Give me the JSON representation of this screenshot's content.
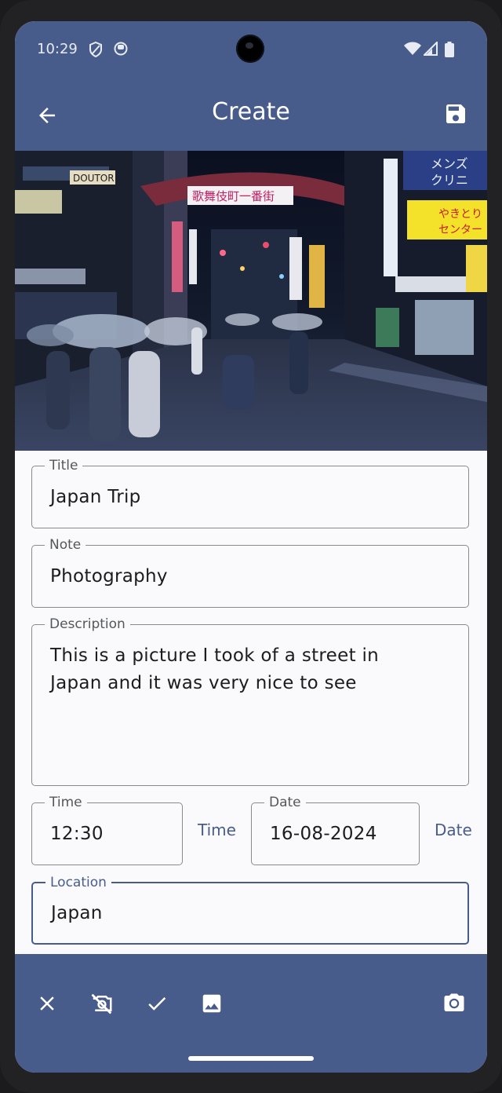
{
  "status": {
    "time": "10:29"
  },
  "appbar": {
    "title": "Create"
  },
  "form": {
    "title": {
      "label": "Title",
      "value": "Japan Trip"
    },
    "note": {
      "label": "Note",
      "value": "Photography"
    },
    "description": {
      "label": "Description",
      "value": "This is a picture I took of a street in Japan and it was very nice to see"
    },
    "time": {
      "label": "Time",
      "value": "12:30",
      "button": "Time"
    },
    "date": {
      "label": "Date",
      "value": "16-08-2024",
      "button": "Date"
    },
    "location": {
      "label": "Location",
      "value": "Japan"
    }
  },
  "photo_signs": {
    "arch": "歌舞伎町一番街",
    "top_right_1": "メンズ",
    "top_right_2": "クリニ",
    "yellow_1": "やきとり",
    "yellow_2": "センター",
    "left": "DOUTOR"
  },
  "colors": {
    "primary": "#485c8c",
    "surface": "#fafafd",
    "outline": "#8a8a8e"
  }
}
